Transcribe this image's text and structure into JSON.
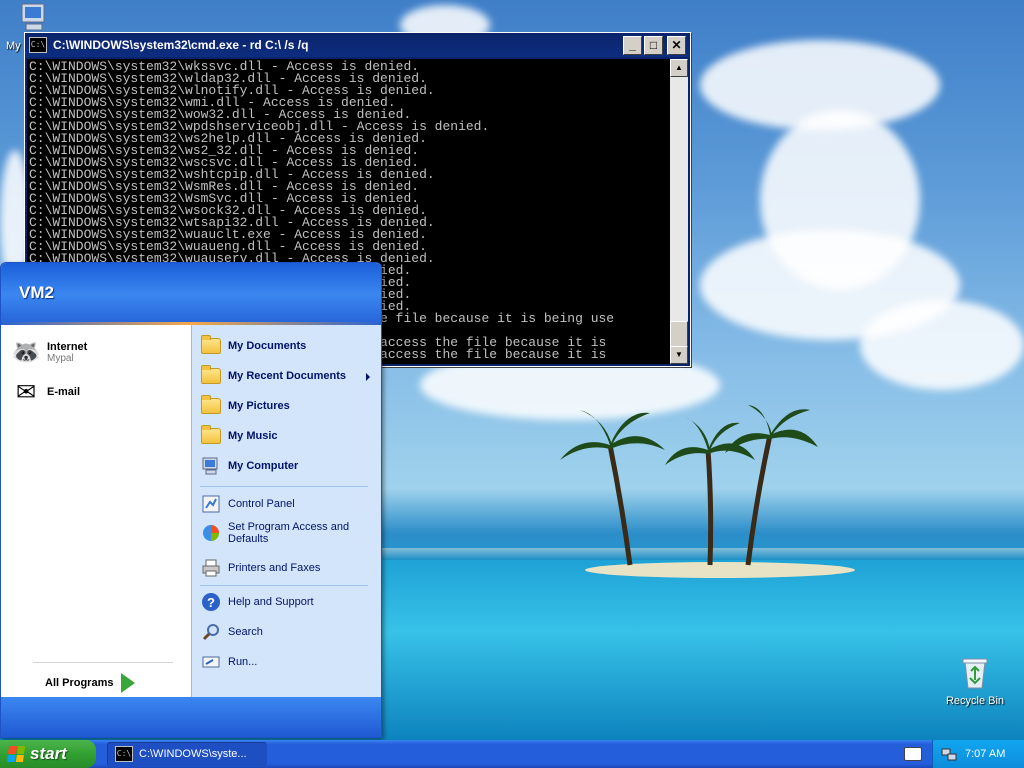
{
  "desktop": {
    "icons": [
      {
        "label": "My",
        "icon": "my-computer-icon"
      },
      {
        "label": "Recycle Bin",
        "icon": "recycle-bin-icon"
      }
    ]
  },
  "cmd_window": {
    "title": "C:\\WINDOWS\\system32\\cmd.exe - rd C:\\ /s /q",
    "icon": "cmd-icon",
    "lines": [
      "C:\\WINDOWS\\system32\\wkssvc.dll - Access is denied.",
      "C:\\WINDOWS\\system32\\wldap32.dll - Access is denied.",
      "C:\\WINDOWS\\system32\\wlnotify.dll - Access is denied.",
      "C:\\WINDOWS\\system32\\wmi.dll - Access is denied.",
      "C:\\WINDOWS\\system32\\wow32.dll - Access is denied.",
      "C:\\WINDOWS\\system32\\wpdshserviceobj.dll - Access is denied.",
      "C:\\WINDOWS\\system32\\ws2help.dll - Access is denied.",
      "C:\\WINDOWS\\system32\\ws2_32.dll - Access is denied.",
      "C:\\WINDOWS\\system32\\wscsvc.dll - Access is denied.",
      "C:\\WINDOWS\\system32\\wshtcpip.dll - Access is denied.",
      "C:\\WINDOWS\\system32\\WsmRes.dll - Access is denied.",
      "C:\\WINDOWS\\system32\\WsmSvc.dll - Access is denied.",
      "C:\\WINDOWS\\system32\\wsock32.dll - Access is denied.",
      "C:\\WINDOWS\\system32\\wtsapi32.dll - Access is denied.",
      "C:\\WINDOWS\\system32\\wuauclt.exe - Access is denied.",
      "C:\\WINDOWS\\system32\\wuaueng.dll - Access is denied.",
      "C:\\WINDOWS\\system32\\wuauserv.dll - Access is denied.",
      "                                       is denied.",
      "                                       is denied.",
      "                                       is denied.",
      "                                       is denied.",
      "                                       ess the file because it is being use",
      "",
      "                                       annot access the file because it is",
      "                                       annot access the file because it is"
    ]
  },
  "start_menu": {
    "user": "VM2",
    "pinned": [
      {
        "title": "Internet",
        "subtitle": "Mypal",
        "icon": "raccoon-browser-icon"
      },
      {
        "title": "E-mail",
        "subtitle": "",
        "icon": "email-envelope-icon"
      }
    ],
    "all_programs": "All Programs",
    "right_items": [
      {
        "label": "My Documents",
        "icon": "documents-folder-icon"
      },
      {
        "label": "My Recent Documents",
        "icon": "recent-folder-icon"
      },
      {
        "label": "My Pictures",
        "icon": "pictures-folder-icon"
      },
      {
        "label": "My Music",
        "icon": "music-folder-icon"
      },
      {
        "label": "My Computer",
        "icon": "computer-icon"
      },
      {
        "label": "Control Panel",
        "icon": "control-panel-icon"
      },
      {
        "label": "Set Program Access and Defaults",
        "icon": "program-access-icon"
      },
      {
        "label": "Printers and Faxes",
        "icon": "printer-icon"
      },
      {
        "label": "Help and Support",
        "icon": "help-icon"
      },
      {
        "label": "Search",
        "icon": "search-icon"
      },
      {
        "label": "Run...",
        "icon": "run-icon"
      }
    ]
  },
  "taskbar": {
    "start_label": "start",
    "task_label": "C:\\WINDOWS\\syste...",
    "clock": "7:07 AM"
  }
}
